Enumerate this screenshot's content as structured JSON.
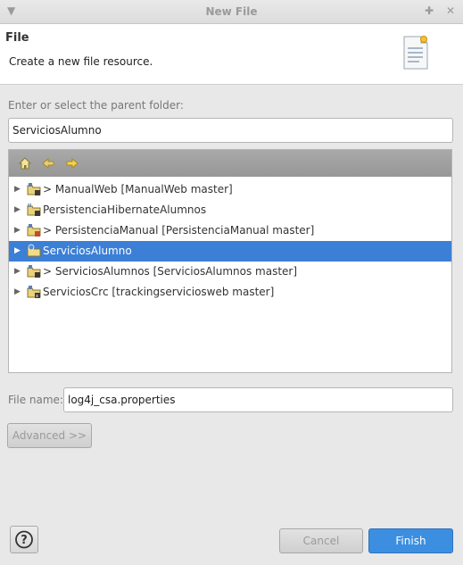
{
  "window": {
    "title": "New File"
  },
  "header": {
    "title": "File",
    "description": "Create a new file resource.",
    "icon": "new-file-icon"
  },
  "parent_folder": {
    "label": "Enter or select the parent folder:",
    "value": "ServiciosAlumno"
  },
  "tree": {
    "toolbar": [
      "home-icon",
      "back-arrow-icon",
      "forward-arrow-icon"
    ],
    "items": [
      {
        "label": "> ManualWeb [ManualWeb master]",
        "icon": "git-project-icon",
        "selected": false
      },
      {
        "label": "PersistenciaHibernateAlumnos",
        "icon": "maven-project-icon",
        "selected": false
      },
      {
        "label": "> PersistenciaManual [PersistenciaManual master]",
        "icon": "git-project-icon",
        "selected": false
      },
      {
        "label": "ServiciosAlumno",
        "icon": "web-project-icon",
        "selected": true
      },
      {
        "label": "> ServiciosAlumnos [ServiciosAlumnos master]",
        "icon": "git-project-icon",
        "selected": false
      },
      {
        "label": "ServiciosCrc [trackingserviciosweb master]",
        "icon": "git-project-icon",
        "selected": false
      }
    ]
  },
  "file_name": {
    "label": "File name:",
    "value": "log4j_csa.properties"
  },
  "advanced_button": "Advanced >>",
  "footer": {
    "help_icon": "help-icon",
    "cancel_label": "Cancel",
    "finish_label": "Finish"
  },
  "colors": {
    "selection": "#3c7fd6",
    "primary_button": "#3c8ee0"
  }
}
